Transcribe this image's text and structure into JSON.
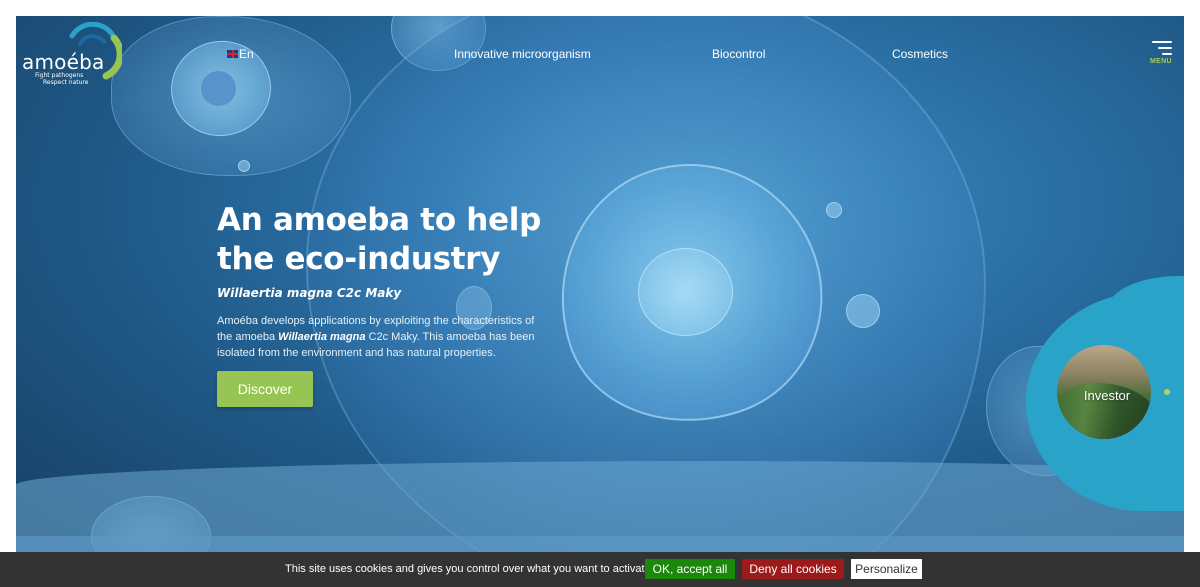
{
  "brand": {
    "name": "amoéba",
    "tagline_line1": "Fight pathogens",
    "tagline_line2": "Respect nature",
    "colors": {
      "green": "#96c553",
      "teal": "#2aa3c8",
      "blue": "#1e5683"
    }
  },
  "nav": {
    "language": {
      "flag_icon": "uk-flag-icon",
      "label": "En"
    },
    "items": [
      {
        "label": "Innovative microorganism"
      },
      {
        "label": "Biocontrol"
      },
      {
        "label": "Cosmetics"
      }
    ],
    "menu_label": "MENU"
  },
  "hero": {
    "title": "An amoeba to help the eco-industry",
    "subtitle": "Willaertia magna C2c Maky",
    "description_part1": "Amoéba develops applications by exploiting the characteristics of the amoeba ",
    "description_emphasis": "Willaertia magna",
    "description_part2": " C2c Maky. This amoeba has been isolated from the environment and has natural properties.",
    "cta_label": "Discover"
  },
  "investor": {
    "label": "Investor"
  },
  "cookie_bar": {
    "message": "This site uses cookies and gives you control over what you want to activate",
    "accept_label": "OK, accept all",
    "deny_label": "Deny all cookies",
    "personalize_label": "Personalize",
    "colors": {
      "accept": "#1b870b",
      "deny": "#9c1a1a",
      "bar": "#333333"
    }
  }
}
